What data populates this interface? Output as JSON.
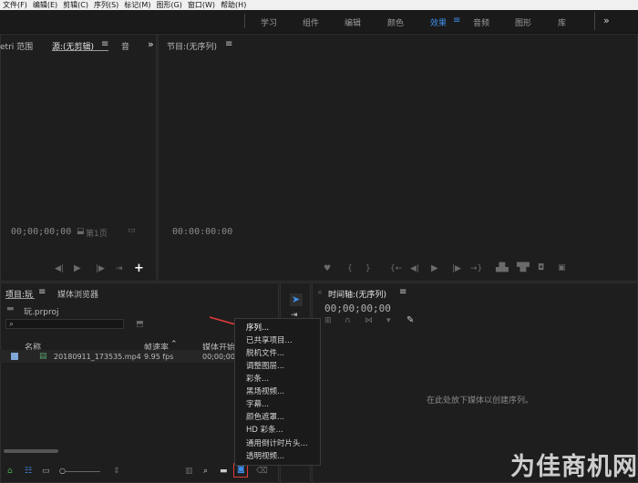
{
  "menubar": [
    "文件(F)",
    "编辑(E)",
    "剪辑(C)",
    "序列(S)",
    "标记(M)",
    "图形(G)",
    "窗口(W)",
    "帮助(H)"
  ],
  "workspaces": [
    {
      "label": "学习",
      "active": false
    },
    {
      "label": "组件",
      "active": false
    },
    {
      "label": "编辑",
      "active": false
    },
    {
      "label": "颜色",
      "active": false
    },
    {
      "label": "效果",
      "active": true
    },
    {
      "label": "音频",
      "active": false
    },
    {
      "label": "图形",
      "active": false
    },
    {
      "label": "库",
      "active": false
    }
  ],
  "workspace_more": "»",
  "source_panel": {
    "tab_lumetri": "etri 范围",
    "tab_source": "源:(无剪辑)",
    "tab_audio": "音",
    "timecode": "00;00;00;00",
    "page": "第1页",
    "more": "»"
  },
  "program_panel": {
    "title": "节目:(无序列)",
    "timecode": "00:00:00:00"
  },
  "project_panel": {
    "tab_project": "项目:玩",
    "tab_media": "媒体浏览器",
    "file": "玩.prproj",
    "col_name": "名称",
    "col_fps": "帧速率",
    "col_start": "媒体开始",
    "row": {
      "name": "20180911_173535.mp4",
      "fps": "9.95 fps",
      "start": "00;00;00"
    }
  },
  "timeline_panel": {
    "title": "时间轴:(无序列)",
    "timecode": "00;00;00;00",
    "empty": "在此处放下媒体以创建序列。"
  },
  "new_item_menu": [
    "序列...",
    "已共享项目...",
    "脱机文件...",
    "调整图层...",
    "彩条...",
    "黑场视频...",
    "字幕...",
    "颜色遮罩...",
    "HD 彩条...",
    "通用倒计时片头...",
    "透明视频..."
  ],
  "watermark": "为佳商机网",
  "colors": {
    "accent": "#3f8ee8",
    "arrow": "#e03a3a",
    "watermark": "#e0e0e0"
  }
}
